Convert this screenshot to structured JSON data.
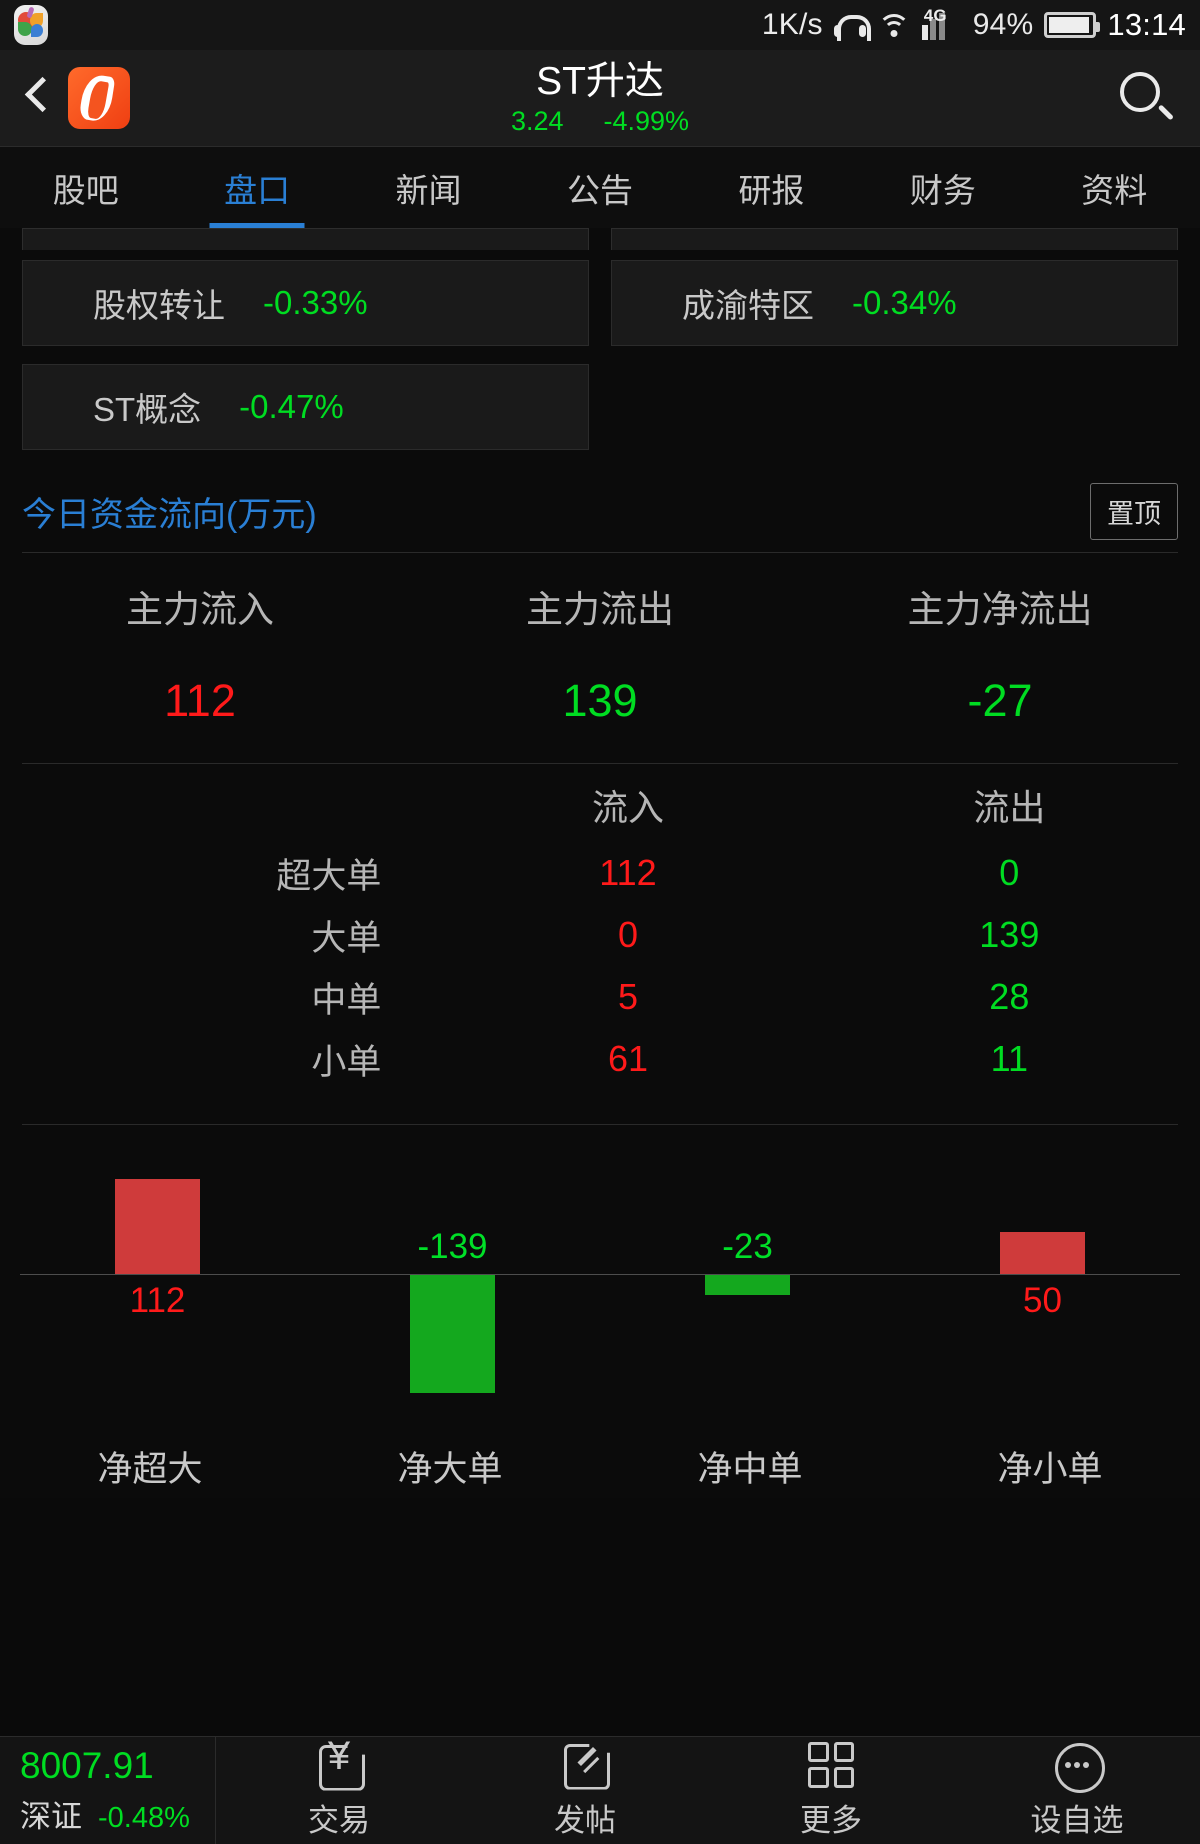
{
  "status_bar": {
    "app_icon": "flower-app-icon",
    "net_speed": "1K/s",
    "headset_icon": "headphones-icon",
    "wifi_icon": "wifi-icon",
    "network_type": "4G",
    "signal_icon": "signal-bars-icon",
    "battery_percent": "94%",
    "battery_icon": "battery-icon",
    "clock": "13:14"
  },
  "header": {
    "back_icon": "back-chevron-icon",
    "logo_icon": "eastmoney-logo-icon",
    "title": "ST升达",
    "price": "3.24",
    "change_percent": "-4.99%",
    "search_icon": "search-icon"
  },
  "tabs": [
    {
      "label": "股吧",
      "active": false
    },
    {
      "label": "盘口",
      "active": true
    },
    {
      "label": "新闻",
      "active": false
    },
    {
      "label": "公告",
      "active": false
    },
    {
      "label": "研报",
      "active": false
    },
    {
      "label": "财务",
      "active": false
    },
    {
      "label": "资料",
      "active": false
    }
  ],
  "concept_chips": [
    {
      "name": "股权转让",
      "value": "-0.33%"
    },
    {
      "name": "成渝特区",
      "value": "-0.34%"
    },
    {
      "name": "ST概念",
      "value": "-0.47%"
    }
  ],
  "fund_flow_section": {
    "title": "今日资金流向(万元)",
    "pin_label": "置顶",
    "summary": [
      {
        "label": "主力流入",
        "value": "112",
        "tone": "red"
      },
      {
        "label": "主力流出",
        "value": "139",
        "tone": "green"
      },
      {
        "label": "主力净流出",
        "value": "-27",
        "tone": "green"
      }
    ],
    "table": {
      "col_headers": [
        "",
        "流入",
        "流出"
      ],
      "rows": [
        {
          "name": "超大单",
          "inflow": "112",
          "outflow": "0"
        },
        {
          "name": "大单",
          "inflow": "0",
          "outflow": "139"
        },
        {
          "name": "中单",
          "inflow": "5",
          "outflow": "28"
        },
        {
          "name": "小单",
          "inflow": "61",
          "outflow": "11"
        }
      ]
    }
  },
  "chart_data": {
    "type": "bar",
    "title": "今日资金流向(万元)",
    "xlabel": "",
    "ylabel": "万元",
    "categories": [
      "净超大",
      "净大单",
      "净中单",
      "净小单"
    ],
    "values": [
      112,
      -139,
      -23,
      50
    ],
    "labels": [
      "112",
      "-139",
      "-23",
      "50"
    ],
    "grid": false,
    "zero_line": true,
    "positive_color": "#cf3b3b",
    "negative_color": "#14a81e",
    "ylim": [
      -160,
      130
    ],
    "legend": "none"
  },
  "bottom_bar": {
    "index": {
      "value": "8007.91",
      "name": "深证",
      "change_percent": "-0.48%"
    },
    "items": [
      {
        "label": "交易",
        "icon": "trade-yen-icon"
      },
      {
        "label": "发帖",
        "icon": "compose-pencil-icon"
      },
      {
        "label": "更多",
        "icon": "grid-more-icon"
      },
      {
        "label": "设自选",
        "icon": "ellipsis-circle-icon"
      }
    ]
  },
  "colors": {
    "up_red": "#ff1a1a",
    "down_green": "#00dd22",
    "accent_blue": "#2a7fd4",
    "bar_red": "#cf3b3b",
    "bar_green": "#14a81e"
  }
}
